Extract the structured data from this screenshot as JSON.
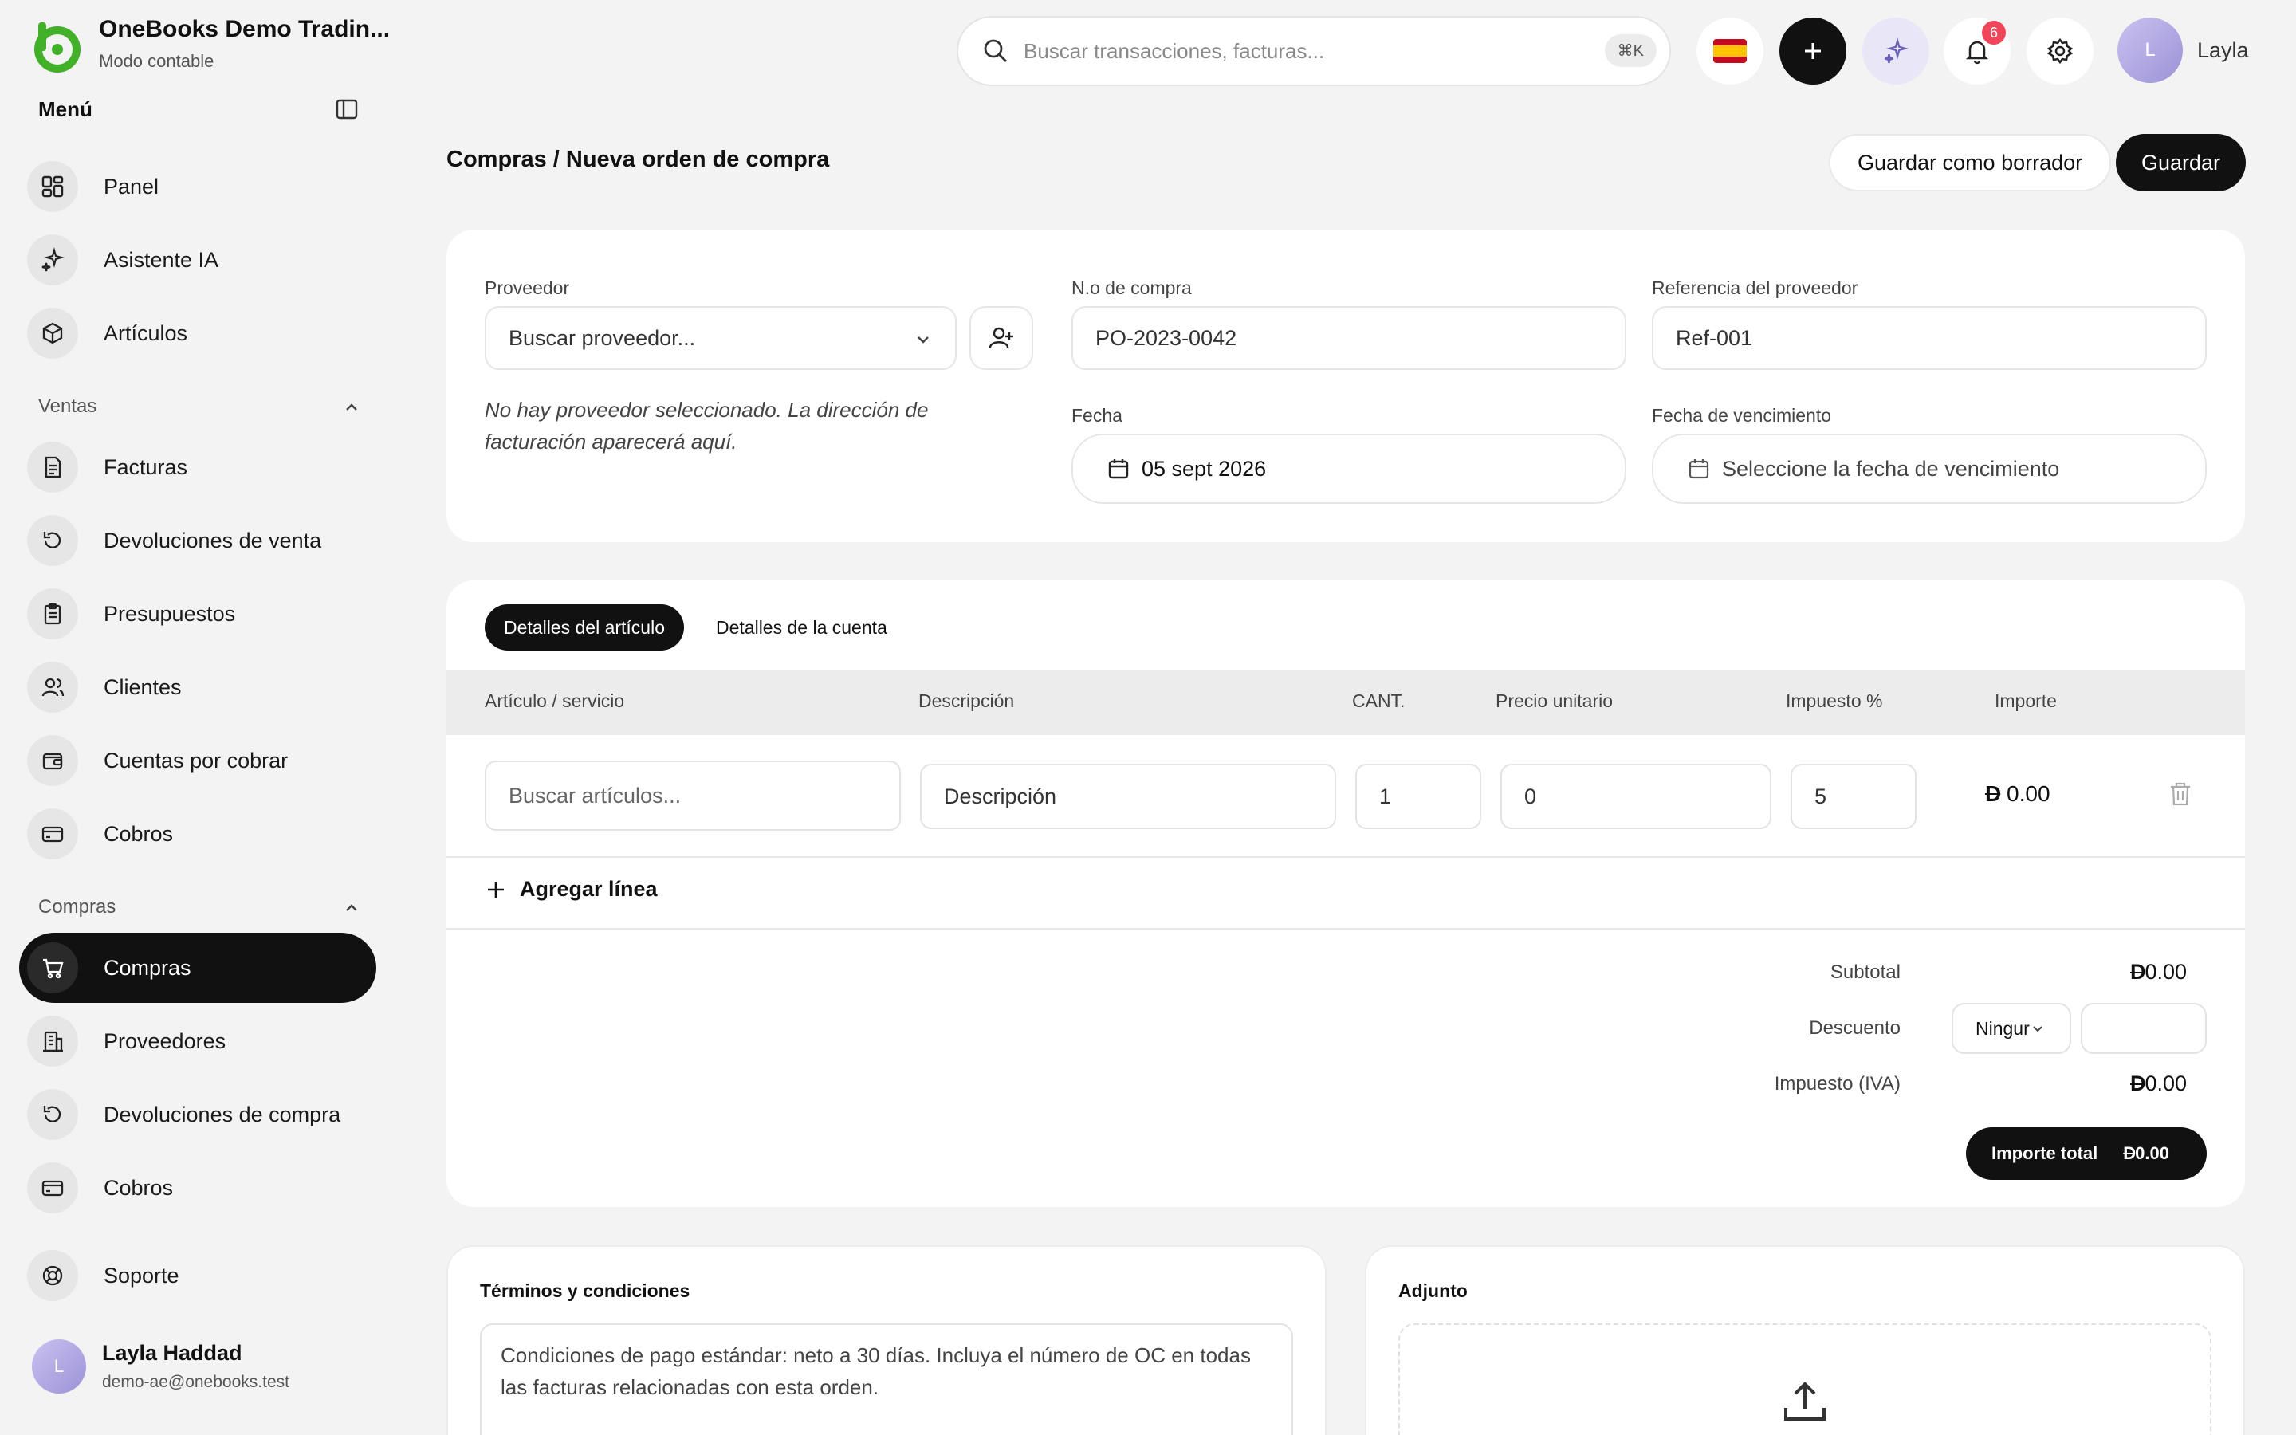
{
  "brand": {
    "name": "OneBooks Demo Tradin...",
    "subtitle": "Modo contable"
  },
  "sidebar": {
    "menu_title": "Menú",
    "top_items": [
      {
        "label": "Panel",
        "icon": "grid-icon"
      },
      {
        "label": "Asistente IA",
        "icon": "sparkle-icon"
      },
      {
        "label": "Artículos",
        "icon": "box-icon"
      }
    ],
    "sections": [
      {
        "title": "Ventas",
        "items": [
          {
            "label": "Facturas",
            "icon": "invoice-icon"
          },
          {
            "label": "Devoluciones de venta",
            "icon": "return-icon"
          },
          {
            "label": "Presupuestos",
            "icon": "clipboard-icon"
          },
          {
            "label": "Clientes",
            "icon": "users-icon"
          },
          {
            "label": "Cuentas por cobrar",
            "icon": "wallet-icon"
          },
          {
            "label": "Cobros",
            "icon": "card-icon"
          }
        ]
      },
      {
        "title": "Compras",
        "items": [
          {
            "label": "Compras",
            "icon": "cart-icon",
            "active": true
          },
          {
            "label": "Proveedores",
            "icon": "building-icon"
          },
          {
            "label": "Devoluciones de compra",
            "icon": "return-icon"
          },
          {
            "label": "Cobros",
            "icon": "card-icon"
          }
        ]
      }
    ],
    "support": {
      "label": "Soporte",
      "icon": "lifebuoy-icon"
    },
    "user": {
      "initial": "L",
      "name": "Layla Haddad",
      "email": "demo-ae@onebooks.test"
    }
  },
  "topbar": {
    "search_placeholder": "Buscar transacciones, facturas...",
    "shortcut": "⌘K",
    "notifications_count": "6",
    "user_initial": "L",
    "user_name": "Layla"
  },
  "page": {
    "breadcrumb": "Compras / Nueva orden de compra",
    "save_draft_label": "Guardar como borrador",
    "save_label": "Guardar"
  },
  "form": {
    "supplier_label": "Proveedor",
    "supplier_placeholder": "Buscar proveedor...",
    "supplier_note": "No hay proveedor seleccionado. La dirección de facturación aparecerá aquí.",
    "po_label": "N.o de compra",
    "po_value": "PO-2023-0042",
    "ref_label": "Referencia del proveedor",
    "ref_value": "Ref-001",
    "date_label": "Fecha",
    "date_value": "05 sept 2026",
    "due_label": "Fecha de vencimiento",
    "due_placeholder": "Seleccione la fecha de vencimiento"
  },
  "items": {
    "tabs": [
      "Detalles del artículo",
      "Detalles de la cuenta"
    ],
    "columns": [
      "Artículo / servicio",
      "Descripción",
      "CANT.",
      "Precio unitario",
      "Impuesto %",
      "Importe"
    ],
    "row": {
      "item_placeholder": "Buscar artículos...",
      "description_placeholder": "Descripción",
      "qty": "1",
      "unit_price": "0",
      "tax": "5",
      "amount": "0.00"
    },
    "add_line_label": "Agregar línea"
  },
  "totals": {
    "currency_symbol": "D",
    "subtotal_label": "Subtotal",
    "subtotal_value": "0.00",
    "discount_label": "Descuento",
    "discount_option": "Ningur",
    "tax_label": "Impuesto (IVA)",
    "tax_value": "0.00",
    "total_label": "Importe total",
    "total_value": "0.00"
  },
  "terms": {
    "title": "Términos y condiciones",
    "text": "Condiciones de pago estándar: neto a 30 días. Incluya el número de OC en todas las facturas relacionadas con esta orden."
  },
  "attachment": {
    "title": "Adjunto"
  },
  "colors": {
    "brand_green": "#43b02a",
    "dark": "#111111",
    "badge": "#f0455b",
    "flag_red": "#c60b1e",
    "flag_yellow": "#ffc400"
  }
}
